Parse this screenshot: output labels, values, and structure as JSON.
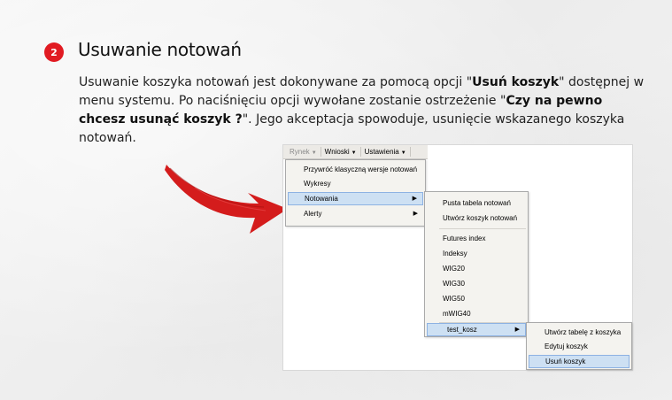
{
  "section": {
    "number": "2",
    "title": "Usuwanie notowań"
  },
  "paragraph": {
    "t1": "Usuwanie koszyka notowań jest dokonywane za pomocą opcji \"",
    "b1": "Usuń koszyk",
    "t2": "\" dostępnej w menu systemu. Po naciśnięciu opcji wywołane zostanie ostrzeżenie \"",
    "b2": "Czy na pewno chcesz usunąć koszyk ?",
    "t3": "\". Jego akceptacja spowoduje, usunięcie wskazanego koszyka notowań."
  },
  "colors": {
    "accent": "#e11b22"
  },
  "screenshot": {
    "menubar": [
      {
        "label": "Rynek"
      },
      {
        "label": "Wnioski"
      },
      {
        "label": "Ustawienia"
      }
    ],
    "menu1": [
      "Przywróć klasyczną wersje notowań",
      "Wykresy",
      "Notowania",
      "Alerty"
    ],
    "menu2": [
      "Pusta tabela notowań",
      "Utwórz koszyk notowań",
      "Futures index",
      "Indeksy",
      "WIG20",
      "WIG30",
      "WIG50",
      "mWIG40",
      "test_kosz"
    ],
    "menu3": [
      "Utwórz tabelę z koszyka",
      "Edytuj koszyk",
      "Usuń koszyk"
    ]
  }
}
